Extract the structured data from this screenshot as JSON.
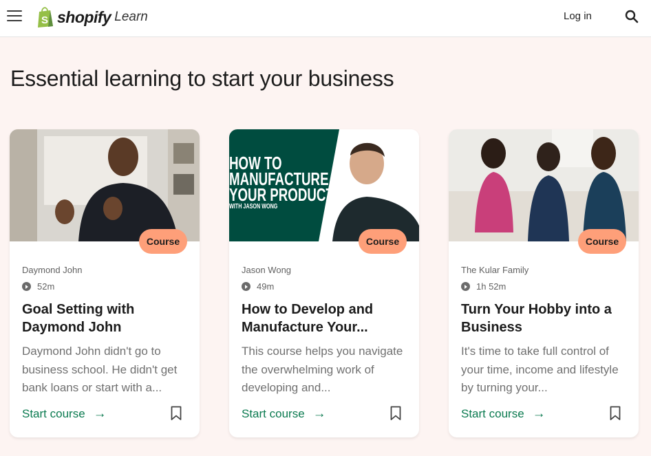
{
  "header": {
    "menu_icon": "hamburger-menu-icon",
    "logo_word": "shopify",
    "logo_suffix": "Learn",
    "login_label": "Log in",
    "search_icon": "search-icon"
  },
  "colors": {
    "page_bg": "#fdf4f2",
    "accent_green": "#0a7a4f",
    "badge_orange": "#fe9f79",
    "logo_green": "#95bf47"
  },
  "section": {
    "title": "Essential learning to start your business"
  },
  "cards": [
    {
      "badge": "Course",
      "author": "Daymond John",
      "duration": "52m",
      "title": "Goal Setting with Daymond John",
      "description": "Daymond John didn't go to business school. He didn't get bank loans or start with a...",
      "cta": "Start course",
      "cta_icon": "arrow-right-icon",
      "bookmark_icon": "bookmark-icon"
    },
    {
      "badge": "Course",
      "author": "Jason Wong",
      "duration": "49m",
      "title": "How to Develop and Manufacture Your...",
      "description": "This course helps you navigate the overwhelming work of developing and...",
      "cta": "Start course",
      "cta_icon": "arrow-right-icon",
      "bookmark_icon": "bookmark-icon",
      "thumb_text": {
        "line1": "HOW TO",
        "line2": "MANUFACTURE",
        "line3": "YOUR PRODUCT",
        "line4": "WITH JASON WONG"
      }
    },
    {
      "badge": "Course",
      "author": "The Kular Family",
      "duration": "1h 52m",
      "title": "Turn Your Hobby into a Business",
      "description": "It's time to take full control of your time, income and lifestyle by turning your...",
      "cta": "Start course",
      "cta_icon": "arrow-right-icon",
      "bookmark_icon": "bookmark-icon"
    }
  ]
}
